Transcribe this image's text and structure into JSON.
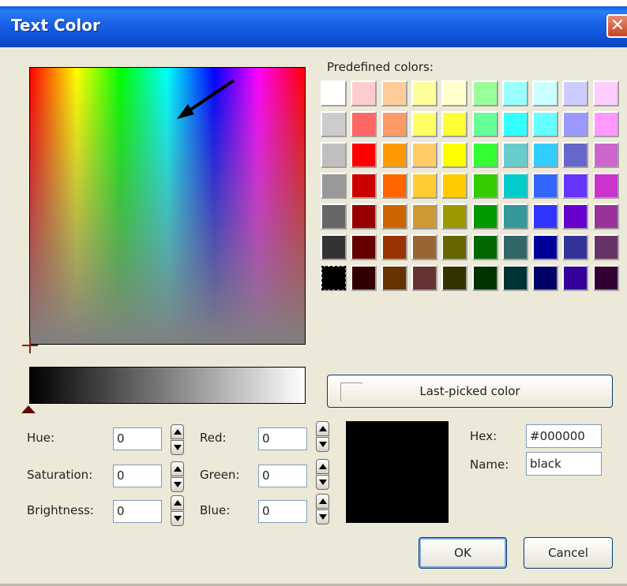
{
  "window": {
    "title": "Text Color",
    "close_label": "✕"
  },
  "predefined": {
    "label": "Predefined colors:",
    "rows": [
      [
        "#ffffff",
        "#ffcccc",
        "#ffcc99",
        "#ffff99",
        "#ffffcc",
        "#99ff99",
        "#99ffff",
        "#ccffff",
        "#ccccff",
        "#ffccff"
      ],
      [
        "#cccccc",
        "#ff6666",
        "#ff9966",
        "#ffff66",
        "#ffff33",
        "#66ff99",
        "#33ffff",
        "#66ffff",
        "#9999ff",
        "#ff99ff"
      ],
      [
        "#c0c0c0",
        "#ff0000",
        "#ff9900",
        "#ffcc66",
        "#ffff00",
        "#33ff33",
        "#66cccc",
        "#33ccff",
        "#6666cc",
        "#cc66cc"
      ],
      [
        "#999999",
        "#cc0000",
        "#ff6600",
        "#ffcc33",
        "#ffcc00",
        "#33cc00",
        "#00cccc",
        "#3366ff",
        "#6633ff",
        "#cc33cc"
      ],
      [
        "#666666",
        "#990000",
        "#cc6600",
        "#cc9933",
        "#999900",
        "#009900",
        "#339999",
        "#3333ff",
        "#6600cc",
        "#993399"
      ],
      [
        "#333333",
        "#660000",
        "#993300",
        "#996633",
        "#666600",
        "#006600",
        "#336666",
        "#000099",
        "#333399",
        "#663366"
      ],
      [
        "#000000",
        "#330000",
        "#663300",
        "#663333",
        "#333300",
        "#003300",
        "#003333",
        "#000066",
        "#330099",
        "#330033"
      ]
    ],
    "selected": "#000000"
  },
  "last_picked": {
    "label": "Last-picked color"
  },
  "fields": {
    "hue": {
      "label": "Hue:",
      "value": "0"
    },
    "saturation": {
      "label": "Saturation:",
      "value": "0"
    },
    "brightness": {
      "label": "Brightness:",
      "value": "0"
    },
    "red": {
      "label": "Red:",
      "value": "0"
    },
    "green": {
      "label": "Green:",
      "value": "0"
    },
    "blue": {
      "label": "Blue:",
      "value": "0"
    },
    "hex": {
      "label": "Hex:",
      "value": "#000000"
    },
    "name": {
      "label": "Name:",
      "value": "black"
    }
  },
  "current_color": "#000000",
  "buttons": {
    "ok": "OK",
    "cancel": "Cancel"
  }
}
